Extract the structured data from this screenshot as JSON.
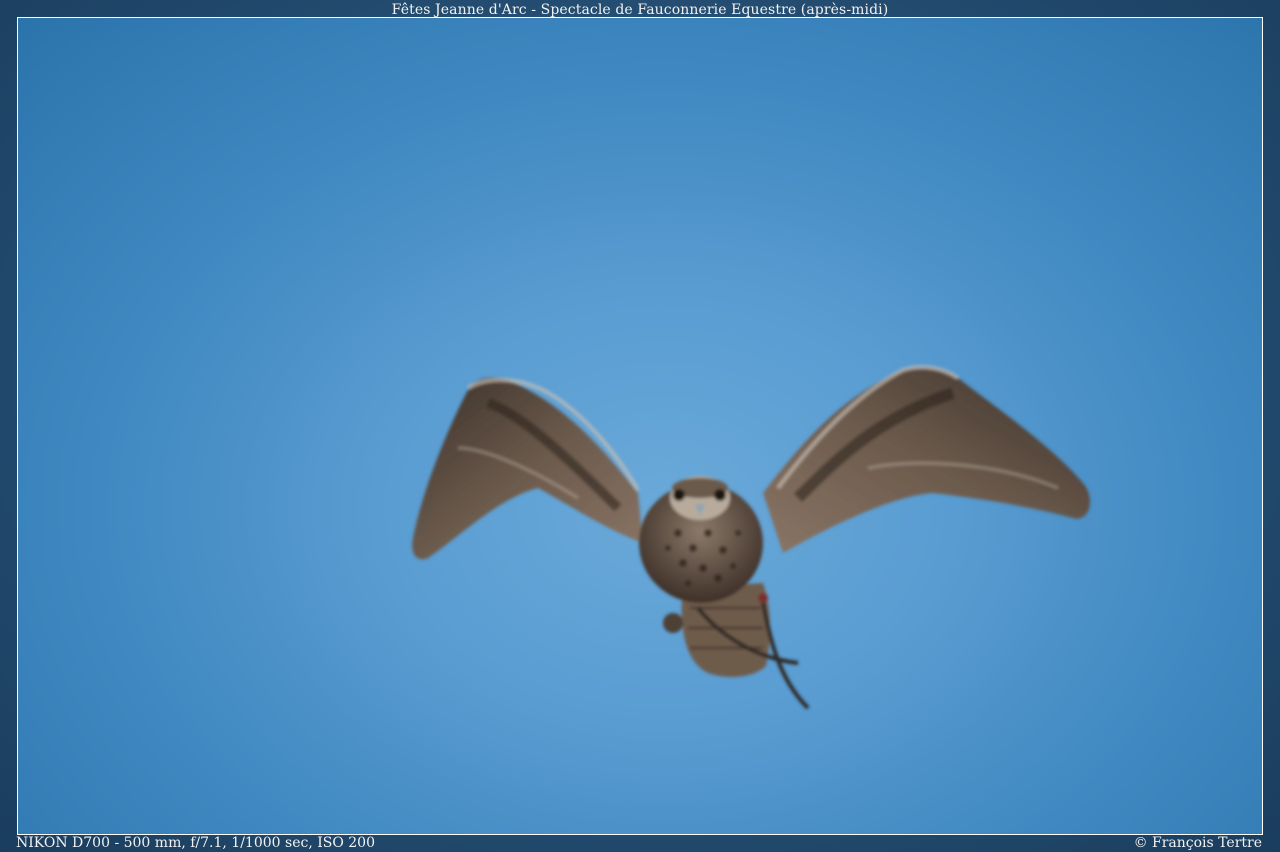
{
  "header": {
    "title": "Fêtes Jeanne d'Arc - Spectacle de Fauconnerie Equestre (après-midi)"
  },
  "photo": {
    "subject_icon": "falcon-in-flight",
    "sky_color": "#5a9dd2"
  },
  "footer": {
    "exif": "NIKON D700 - 500 mm, f/7.1, 1/1000 sec, ISO 200",
    "copyright": "© François Tertre"
  }
}
